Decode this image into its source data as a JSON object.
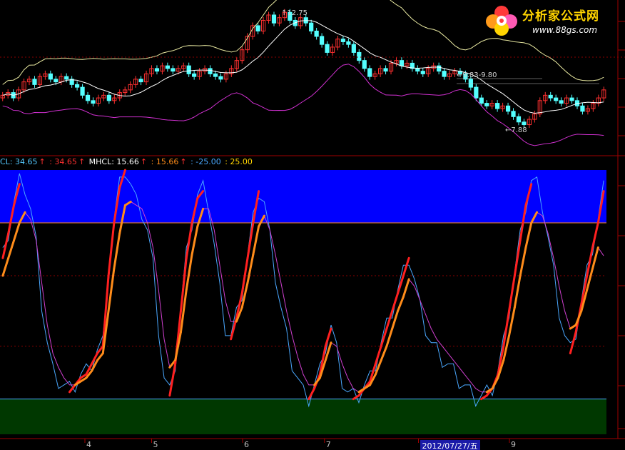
{
  "colors": {
    "background": "#000000",
    "up_candle": "#ff3030",
    "down_candle": "#54ffff",
    "boll_upper": "#e8e8a0",
    "boll_mid": "#ffffff",
    "boll_lower": "#d030d0",
    "overbought_band": "#0000ff",
    "oversold_band": "#003800",
    "separator": "#a00000",
    "fast_line": "#ff2020",
    "slow_line": "#ff8c1a",
    "thin_blue": "#4aa8ff",
    "thin_magenta": "#d040d0"
  },
  "legend": {
    "cl_label": "CL: 34.65",
    "cl_arrow": "↑",
    "cl_value": ": 34.65",
    "cl_value_arrow": "↑",
    "mhcl_label": "MHCL: 15.66",
    "mhcl_arrow": "↑",
    "mhcl_value": ": 15.66",
    "mhcl_value_arrow": "↑",
    "neg": ": -25.00",
    "pos": ": 25.00"
  },
  "watermark": {
    "text": "分析家公式网",
    "url": "www.88gs.com"
  },
  "annotations": {
    "high": "12.75",
    "mid": "9.83-9.80",
    "low": "7.88"
  },
  "x_axis": {
    "ticks": [
      {
        "label": "4",
        "pos": 0.14
      },
      {
        "label": "5",
        "pos": 0.25
      },
      {
        "label": "6",
        "pos": 0.4
      },
      {
        "label": "7",
        "pos": 0.535
      },
      {
        "label": "2012/07/27/五",
        "pos": 0.69,
        "highlight": true
      },
      {
        "label": "9",
        "pos": 0.84
      }
    ]
  },
  "chart_data": [
    {
      "type": "candlestick",
      "annotations": [
        "12.75",
        "9.83-9.80",
        "7.88"
      ],
      "close": [
        9.6,
        9.7,
        9.5,
        9.8,
        10.1,
        10.2,
        10.0,
        10.3,
        10.4,
        10.2,
        10.1,
        10.3,
        10.2,
        10.0,
        9.9,
        9.6,
        9.4,
        9.3,
        9.5,
        9.6,
        9.4,
        9.5,
        9.7,
        9.8,
        10.0,
        10.2,
        10.1,
        10.4,
        10.6,
        10.5,
        10.7,
        10.6,
        10.5,
        10.6,
        10.7,
        10.4,
        10.3,
        10.5,
        10.6,
        10.4,
        10.3,
        10.2,
        10.4,
        10.6,
        10.9,
        11.3,
        11.8,
        12.2,
        12.0,
        12.4,
        12.6,
        12.3,
        12.5,
        12.7,
        12.4,
        12.2,
        12.5,
        12.3,
        12.0,
        11.8,
        11.5,
        11.2,
        11.4,
        11.7,
        11.6,
        11.5,
        11.2,
        10.9,
        10.6,
        10.3,
        10.4,
        10.6,
        10.5,
        10.8,
        10.9,
        10.7,
        10.8,
        10.6,
        10.5,
        10.4,
        10.6,
        10.7,
        10.5,
        10.3,
        10.4,
        10.5,
        10.4,
        10.2,
        9.9,
        9.5,
        9.3,
        9.2,
        9.3,
        9.1,
        9.2,
        9.0,
        8.8,
        8.6,
        8.5,
        8.7,
        8.9,
        9.4,
        9.6,
        9.5,
        9.4,
        9.3,
        9.5,
        9.4,
        9.2,
        9.0,
        9.1,
        9.3,
        9.5,
        9.8
      ],
      "ylim": [
        7.5,
        13.0
      ]
    },
    {
      "type": "line",
      "series": [
        {
          "name": "CL",
          "values": [
            15,
            22,
            30,
            36,
            35,
            28,
            18,
            2,
            -10,
            -18,
            -20,
            -22,
            -23,
            -21,
            -19,
            -18,
            -15,
            -12,
            -10,
            10,
            25,
            35,
            40,
            35,
            30,
            28,
            22,
            12,
            -5,
            -20,
            -24,
            -15,
            0,
            15,
            25,
            32,
            34,
            30,
            18,
            5,
            -5,
            -8,
            -2,
            5,
            15,
            25,
            34,
            30,
            20,
            10,
            0,
            -8,
            -15,
            -20,
            -24,
            -25,
            -22,
            -18,
            -10,
            -5,
            -12,
            -20,
            -24,
            -25,
            -24,
            -22,
            -20,
            -15,
            -10,
            -5,
            0,
            5,
            10,
            15,
            8,
            0,
            -5,
            -10,
            -12,
            -14,
            -16,
            -18,
            -20,
            -22,
            -24,
            -25,
            -25,
            -24,
            -22,
            -18,
            -10,
            0,
            10,
            20,
            30,
            36,
            35,
            30,
            20,
            10,
            0,
            -8,
            -12,
            -6,
            2,
            10,
            18,
            25,
            34
          ]
        },
        {
          "name": "MHCL",
          "values": [
            10,
            15,
            20,
            25,
            28,
            26,
            20,
            8,
            -4,
            -12,
            -16,
            -19,
            -21,
            -21,
            -20,
            -19,
            -17,
            -14,
            -12,
            0,
            12,
            22,
            30,
            31,
            30,
            29,
            25,
            18,
            6,
            -8,
            -16,
            -14,
            -6,
            6,
            16,
            24,
            29,
            29,
            23,
            13,
            3,
            -3,
            -3,
            1,
            8,
            16,
            24,
            27,
            23,
            16,
            8,
            0,
            -7,
            -13,
            -18,
            -21,
            -21,
            -19,
            -14,
            -9,
            -10,
            -15,
            -19,
            -22,
            -23,
            -22,
            -21,
            -18,
            -14,
            -10,
            -5,
            0,
            4,
            9,
            7,
            3,
            -1,
            -5,
            -8,
            -10,
            -12,
            -14,
            -16,
            -18,
            -20,
            -22,
            -23,
            -23,
            -22,
            -19,
            -14,
            -7,
            1,
            10,
            18,
            25,
            28,
            27,
            22,
            15,
            7,
            0,
            -5,
            -4,
            0,
            6,
            12,
            18,
            15.66
          ]
        }
      ],
      "bands": {
        "upper": 25,
        "lower": -25
      },
      "ylim": [
        -35,
        40
      ]
    }
  ]
}
